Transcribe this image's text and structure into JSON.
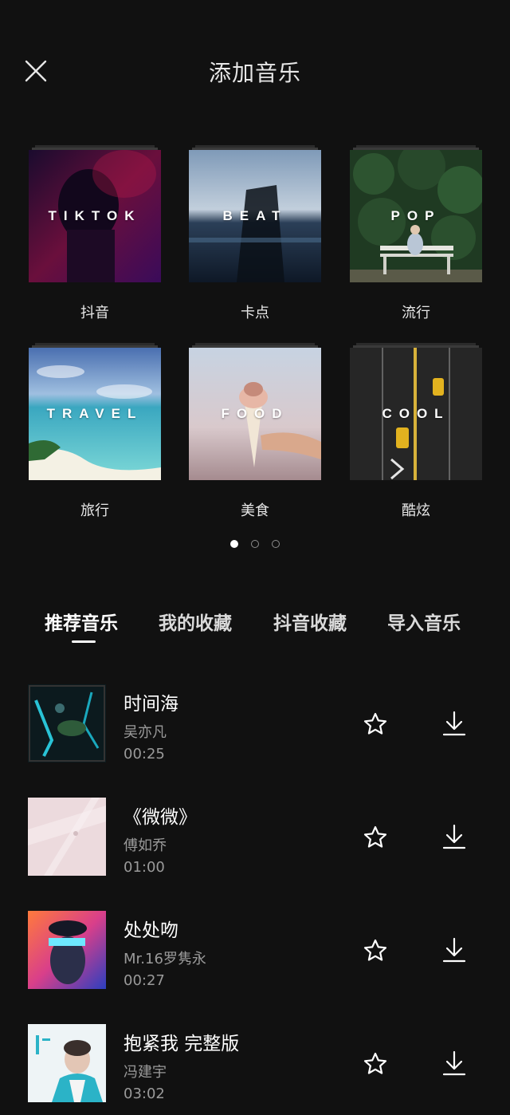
{
  "header": {
    "title": "添加音乐",
    "close_icon": "close-icon"
  },
  "categories": [
    {
      "overlay": "TIKTOK",
      "label": "抖音"
    },
    {
      "overlay": "BEAT",
      "label": "卡点"
    },
    {
      "overlay": "POP",
      "label": "流行"
    },
    {
      "overlay": "TRAVEL",
      "label": "旅行"
    },
    {
      "overlay": "FOOD",
      "label": "美食"
    },
    {
      "overlay": "COOL",
      "label": "酷炫"
    }
  ],
  "pagination": {
    "count": 3,
    "active": 0
  },
  "tabs": [
    {
      "label": "推荐音乐",
      "active": true
    },
    {
      "label": "我的收藏",
      "active": false
    },
    {
      "label": "抖音收藏",
      "active": false
    },
    {
      "label": "导入音乐",
      "active": false
    }
  ],
  "songs": [
    {
      "title": "时间海",
      "artist": "吴亦凡",
      "duration": "00:25"
    },
    {
      "title": "《微微》",
      "artist": "傅如乔",
      "duration": "01:00"
    },
    {
      "title": "处处吻",
      "artist": "Mr.16罗隽永",
      "duration": "00:27"
    },
    {
      "title": "抱紧我 完整版",
      "artist": "冯建宇",
      "duration": "03:02"
    }
  ],
  "icons": {
    "favorite": "star-icon",
    "download": "download-icon"
  },
  "colors": {
    "background": "#111111",
    "text": "#ffffff",
    "secondary_text": "#9a9a9a"
  }
}
